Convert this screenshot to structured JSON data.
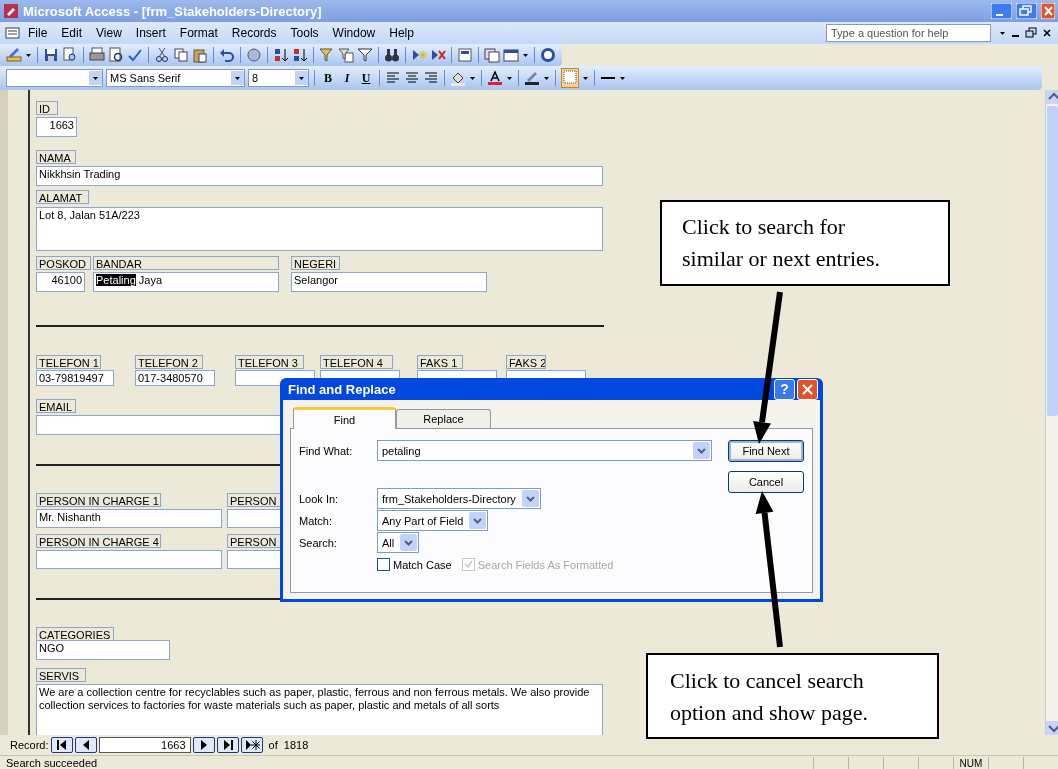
{
  "window": {
    "title": "Microsoft Access - [frm_Stakeholders-Directory]"
  },
  "menu": [
    {
      "label": "File"
    },
    {
      "label": "Edit"
    },
    {
      "label": "View"
    },
    {
      "label": "Insert"
    },
    {
      "label": "Format"
    },
    {
      "label": "Records"
    },
    {
      "label": "Tools"
    },
    {
      "label": "Window"
    },
    {
      "label": "Help"
    }
  ],
  "help_box": {
    "placeholder": "Type a question for help"
  },
  "formatting_toolbar": {
    "font": "MS Sans Serif",
    "size": "8",
    "bold": "B",
    "italic": "I",
    "underline": "U"
  },
  "form": {
    "fields": [
      {
        "label": "ID",
        "value": "1663",
        "right_aligned": true
      },
      {
        "label": "NAMA",
        "value": "Nikkhsin Trading",
        "right_aligned": false
      },
      {
        "label": "ALAMAT",
        "value": "Lot 8, Jalan 51A/223",
        "right_aligned": false
      },
      {
        "label": "POSKOD",
        "value": "46100",
        "right_aligned": true
      },
      {
        "label": "BANDAR",
        "right_aligned": false,
        "value_parts": [
          {
            "text": "Petaling",
            "selected": true
          },
          {
            "text": " Jaya",
            "selected": false
          }
        ]
      },
      {
        "label": "NEGERI",
        "value": "Selangor",
        "right_aligned": false
      },
      {
        "label": "TELEFON 1",
        "value": "03-79819497",
        "right_aligned": false
      },
      {
        "label": "TELEFON 2",
        "value": "017-3480570",
        "right_aligned": false
      },
      {
        "label": "TELEFON 3"
      },
      {
        "label": "TELEFON 4"
      },
      {
        "label": "FAKS 1"
      },
      {
        "label": "FAKS 2"
      },
      {
        "label": "EMAIL"
      },
      {
        "label": "PERSON IN CHARGE 1",
        "value": "Mr. Nishanth",
        "right_aligned": false
      },
      {
        "label": "PERSON"
      },
      {
        "label": "PERSON IN CHARGE 4"
      },
      {
        "label": "PERSON"
      },
      {
        "label": "CATEGORIES",
        "value": "NGO",
        "right_aligned": false
      },
      {
        "label": "SERVIS",
        "right_aligned": false,
        "value": "We are a collection centre for recyclables such as paper, plastic, ferrous and non ferrous metals. We also provide collection services to factories for waste materials such as paper, plastic and metals of all sorts"
      }
    ]
  },
  "record_nav": {
    "label": "Record:",
    "current": "1663",
    "total": "of  1818"
  },
  "status_bar": {
    "message": "Search succeeded",
    "indicators": [
      "NUM"
    ]
  },
  "dialog": {
    "title": "Find and Replace",
    "help_button": "?",
    "tabs": [
      {
        "label": "Find",
        "selected": true
      },
      {
        "label": "Replace",
        "selected": false
      }
    ],
    "rows": [
      {
        "label": "Find What:",
        "value": "petaling",
        "kind": "wide"
      },
      {
        "label": "Look In:",
        "value": "frm_Stakeholders-Directory",
        "kind": "combo"
      },
      {
        "label": "Match:",
        "value": "Any Part of Field",
        "kind": "combo"
      },
      {
        "label": "Search:",
        "value": "All",
        "kind": "combo"
      }
    ],
    "checkboxes": [
      {
        "label": "Match Case",
        "checked": false,
        "disabled": false
      },
      {
        "label": "Search Fields As Formatted",
        "checked": true,
        "disabled": true
      }
    ],
    "buttons": [
      {
        "label": "Find Next",
        "default": true
      },
      {
        "label": "Cancel",
        "default": false
      }
    ]
  },
  "callouts": [
    {
      "text": "Click to search for similar or next entries."
    },
    {
      "text": "Click to cancel search option and show page."
    }
  ]
}
